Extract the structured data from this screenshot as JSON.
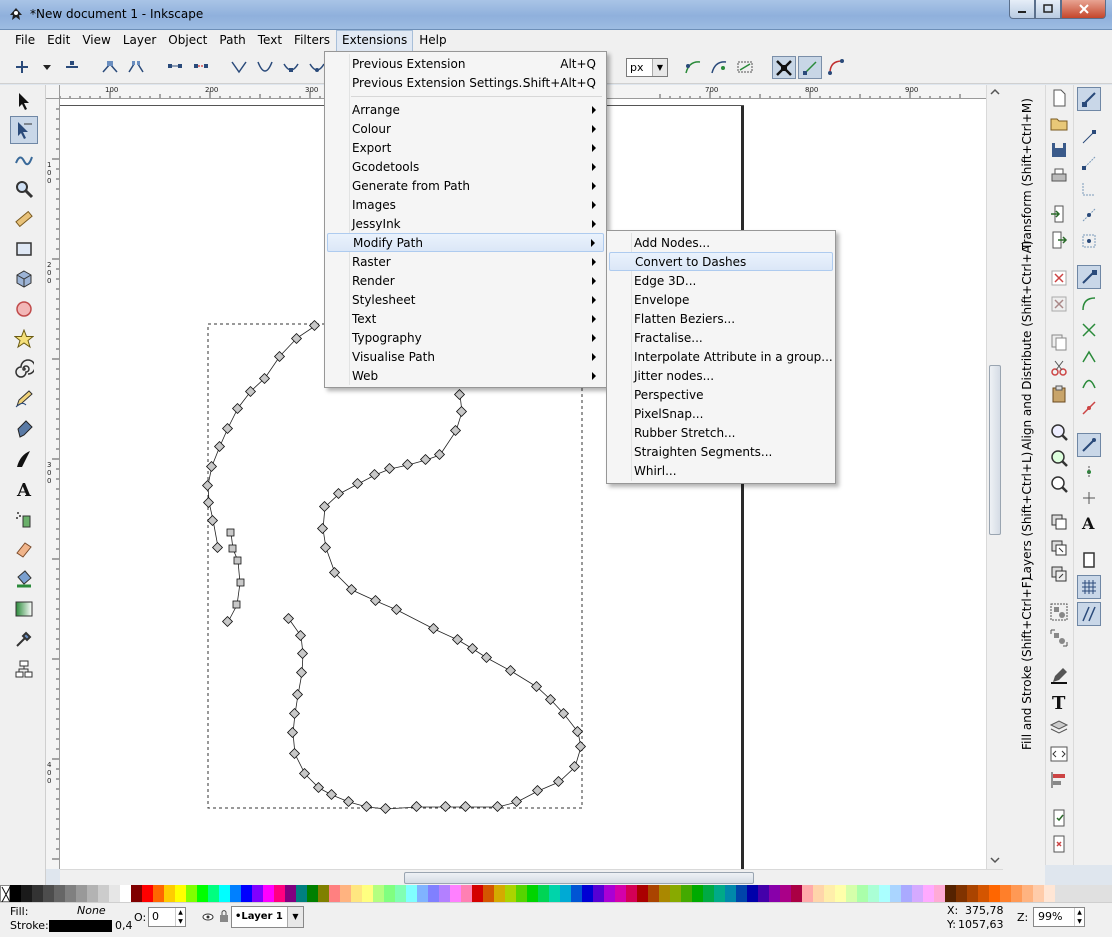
{
  "window": {
    "title": "*New document 1 - Inkscape"
  },
  "menubar": [
    "File",
    "Edit",
    "View",
    "Layer",
    "Object",
    "Path",
    "Text",
    "Filters",
    "Extensions",
    "Help"
  ],
  "toolcontrols": {
    "unit": "px"
  },
  "ruler_h": [
    "100",
    "200",
    "300",
    "700",
    "800",
    "900"
  ],
  "ruler_v": [
    "1",
    "0",
    "0",
    "2",
    "0",
    "0",
    "3",
    "0",
    "0",
    "4",
    "0",
    "0"
  ],
  "extensions_menu": {
    "top_items": [
      {
        "label": "Previous Extension",
        "accel": "Alt+Q"
      },
      {
        "label": "Previous Extension Settings...",
        "accel": "Shift+Alt+Q"
      }
    ],
    "submenus": [
      "Arrange",
      "Colour",
      "Export",
      "Gcodetools",
      "Generate from Path",
      "Images",
      "JessyInk",
      "Modify Path",
      "Raster",
      "Render",
      "Stylesheet",
      "Text",
      "Typography",
      "Visualise Path",
      "Web"
    ],
    "highlighted": "Modify Path"
  },
  "modify_path_menu": {
    "items": [
      "Add Nodes...",
      "Convert to Dashes",
      "Edge 3D...",
      "Envelope",
      "Flatten Beziers...",
      "Fractalise...",
      "Interpolate Attribute in a group...",
      "Jitter nodes...",
      "Perspective",
      "PixelSnap...",
      "Rubber Stretch...",
      "Straighten Segments...",
      "Whirl..."
    ],
    "highlighted": "Convert to Dashes"
  },
  "dock_tabs": [
    "Transform (Shift+Ctrl+M)",
    "Align and Distribute (Shift+Ctrl+A)",
    "Layers (Shift+Ctrl+L)",
    "Fill and Stroke (Shift+Ctrl+F)"
  ],
  "status": {
    "fill_label": "Fill:",
    "fill_value": "None",
    "stroke_label": "Stroke:",
    "stroke_width": "0,4",
    "opacity_label": "O:",
    "opacity_value": "0",
    "layer": "•Layer 1",
    "x_label": "X:",
    "x_value": "375,78",
    "y_label": "Y:",
    "y_value": "1057,63",
    "zoom_label": "Z:",
    "zoom_value": "99%"
  },
  "palette_colors": [
    "#000000",
    "#1a1a1a",
    "#333333",
    "#4d4d4d",
    "#666666",
    "#808080",
    "#999999",
    "#b3b3b3",
    "#cccccc",
    "#e6e6e6",
    "#ffffff",
    "#800000",
    "#ff0000",
    "#ff6600",
    "#ffcc00",
    "#ffff00",
    "#80ff00",
    "#00ff00",
    "#00ff80",
    "#00ffff",
    "#0080ff",
    "#0000ff",
    "#8000ff",
    "#ff00ff",
    "#ff0080",
    "#800080",
    "#008080",
    "#008000",
    "#808000",
    "#ff8080",
    "#ffb380",
    "#ffe680",
    "#ffff80",
    "#b3ff80",
    "#80ff80",
    "#80ffb3",
    "#80ffff",
    "#80b3ff",
    "#8080ff",
    "#b380ff",
    "#ff80ff",
    "#ff80b3",
    "#d40000",
    "#d45500",
    "#d4aa00",
    "#aad400",
    "#55d400",
    "#00d400",
    "#00d455",
    "#00d4aa",
    "#00aad4",
    "#0055d4",
    "#0000d4",
    "#5500d4",
    "#aa00d4",
    "#d400aa",
    "#d40055",
    "#aa0000",
    "#aa4400",
    "#aa8800",
    "#88aa00",
    "#44aa00",
    "#00aa00",
    "#00aa44",
    "#00aa88",
    "#0088aa",
    "#0044aa",
    "#0000aa",
    "#4400aa",
    "#8800aa",
    "#aa0088",
    "#aa0044",
    "#ffaaaa",
    "#ffd5aa",
    "#ffeeaa",
    "#ffffaa",
    "#d5ffaa",
    "#aaffaa",
    "#aaffd5",
    "#aaffff",
    "#aad5ff",
    "#aaaaff",
    "#d5aaff",
    "#ffaaff",
    "#ffaad5",
    "#552200",
    "#803300",
    "#aa4400",
    "#d45500",
    "#ff6600",
    "#ff7f2a",
    "#ff9955",
    "#ffb380",
    "#ffccaa",
    "#ffe6d5"
  ]
}
